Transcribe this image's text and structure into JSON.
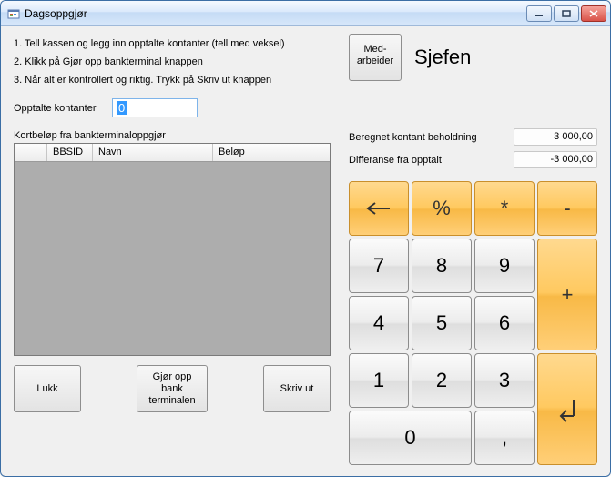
{
  "window": {
    "title": "Dagsoppgjør"
  },
  "instructions": {
    "line1": "1. Tell kassen og legg inn opptalte kontanter (tell med veksel)",
    "line2": "2. Klikk på Gjør opp bankterminal knappen",
    "line3": "3. Når alt er kontrollert og riktig. Trykk på Skriv ut knappen"
  },
  "opptalte": {
    "label": "Opptalte kontanter",
    "value": "0"
  },
  "grid": {
    "caption": "Kortbeløp fra bankterminaloppgjør",
    "cols": {
      "bbsid": "BBSID",
      "navn": "Navn",
      "belop": "Beløp"
    }
  },
  "buttons": {
    "lukk": "Lukk",
    "gjor": "Gjør opp bank terminalen",
    "skriv": "Skriv ut",
    "medarbeider": "Med-arbeider"
  },
  "employee": {
    "name": "Sjefen"
  },
  "summary": {
    "beregnet_label": "Beregnet kontant beholdning",
    "beregnet_value": "3 000,00",
    "differanse_label": "Differanse fra opptalt",
    "differanse_value": "-3 000,00"
  },
  "keypad": {
    "percent": "%",
    "multiply": "*",
    "minus": "-",
    "plus": "+",
    "k7": "7",
    "k8": "8",
    "k9": "9",
    "k4": "4",
    "k5": "5",
    "k6": "6",
    "k1": "1",
    "k2": "2",
    "k3": "3",
    "k0": "0",
    "comma": ","
  }
}
